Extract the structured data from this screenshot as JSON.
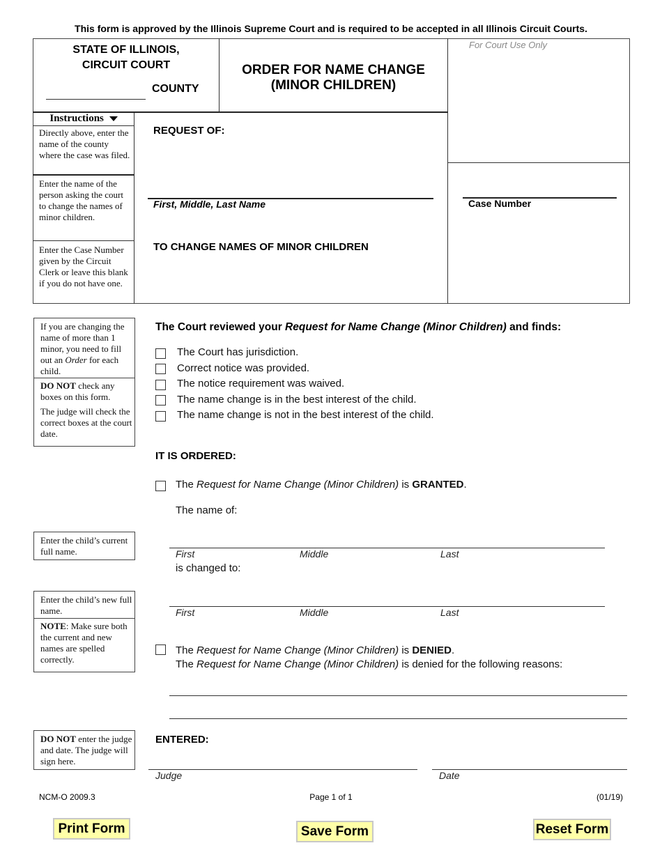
{
  "approval_notice": "This form is approved by the Illinois Supreme Court and is required to be accepted in all Illinois Circuit Courts.",
  "header": {
    "state_line1": "STATE OF ILLINOIS,",
    "state_line2": "CIRCUIT COURT",
    "county_label": "COUNTY",
    "county_value": "",
    "form_title_line1": "ORDER FOR NAME CHANGE",
    "form_title_line2": "(MINOR CHILDREN)",
    "court_use_label": "For Court Use Only"
  },
  "instructions": {
    "toggle_label": "Instructions",
    "county_help": "Directly above, enter the name of the county where the case was filed.",
    "requester_help": "Enter the name of the person asking the court to change the names of minor children.",
    "case_number_help": "Enter the Case Number given by the Circuit Clerk or leave this blank if you do not have one.",
    "multiple_minors_help_pre": "If you are changing the name of more than 1 minor, you need to fill out an ",
    "multiple_minors_help_em": "Order",
    "multiple_minors_help_post": " for each child.",
    "do_not_check_bold": "DO NOT",
    "do_not_check_rest": " check any boxes on this form.",
    "judge_will_check": "The judge will check the correct boxes at the court date.",
    "current_name_help": "Enter the child’s current full name.",
    "new_name_help": "Enter the child’s new full name.",
    "note_bold": "NOTE",
    "note_rest": ": Make sure both the current and new names are spelled correctly.",
    "judge_date_bold": "DO NOT",
    "judge_date_rest": " enter the judge and date. The judge will sign here."
  },
  "request": {
    "request_of_label": "REQUEST OF:",
    "name_value": "",
    "name_caption": "First, Middle, Last Name",
    "subtitle": "TO CHANGE NAMES OF MINOR CHILDREN",
    "case_number_value": "",
    "case_number_caption": "Case Number"
  },
  "findings": {
    "heading_pre": "The Court reviewed your ",
    "heading_em": "Request for Name Change (Minor Children)",
    "heading_post": " and finds:",
    "items": [
      {
        "label": "The Court has jurisdiction.",
        "checked": false
      },
      {
        "label": "Correct notice was provided.",
        "checked": false
      },
      {
        "label": "The notice requirement was waived.",
        "checked": false
      },
      {
        "label": "The name change is in the best interest of the child.",
        "checked": false
      },
      {
        "label": "The name change is not in the best interest of the child.",
        "checked": false
      }
    ]
  },
  "order": {
    "heading": "IT IS ORDERED:",
    "granted_pre": "The ",
    "granted_em": "Request for Name Change (Minor Children)",
    "granted_mid": " is ",
    "granted_bold": "GRANTED",
    "granted_post": ".",
    "granted_checked": false,
    "name_of_label": "The name of:",
    "current_name": {
      "first": "",
      "middle": "",
      "last": ""
    },
    "changed_to_label": "is changed to:",
    "new_name": {
      "first": "",
      "middle": "",
      "last": ""
    },
    "col_first": "First",
    "col_middle": "Middle",
    "col_last": "Last",
    "denied_pre": "The ",
    "denied_em": "Request for Name Change (Minor Children)",
    "denied_mid": " is ",
    "denied_bold": "DENIED",
    "denied_post": ".",
    "denied_checked": false,
    "reasons_pre": "The ",
    "reasons_em": "Request for Name Change (Minor Children)",
    "reasons_post": " is denied for the following reasons:",
    "reason_line1": "",
    "reason_line2": ""
  },
  "entered": {
    "heading": "ENTERED:",
    "judge_caption": "Judge",
    "date_caption": "Date"
  },
  "footer": {
    "form_code": "NCM-O 2009.3",
    "page_info": "Page 1 of 1",
    "revision": "(01/19)"
  },
  "buttons": {
    "print": "Print Form",
    "save": "Save Form",
    "reset": "Reset Form"
  }
}
